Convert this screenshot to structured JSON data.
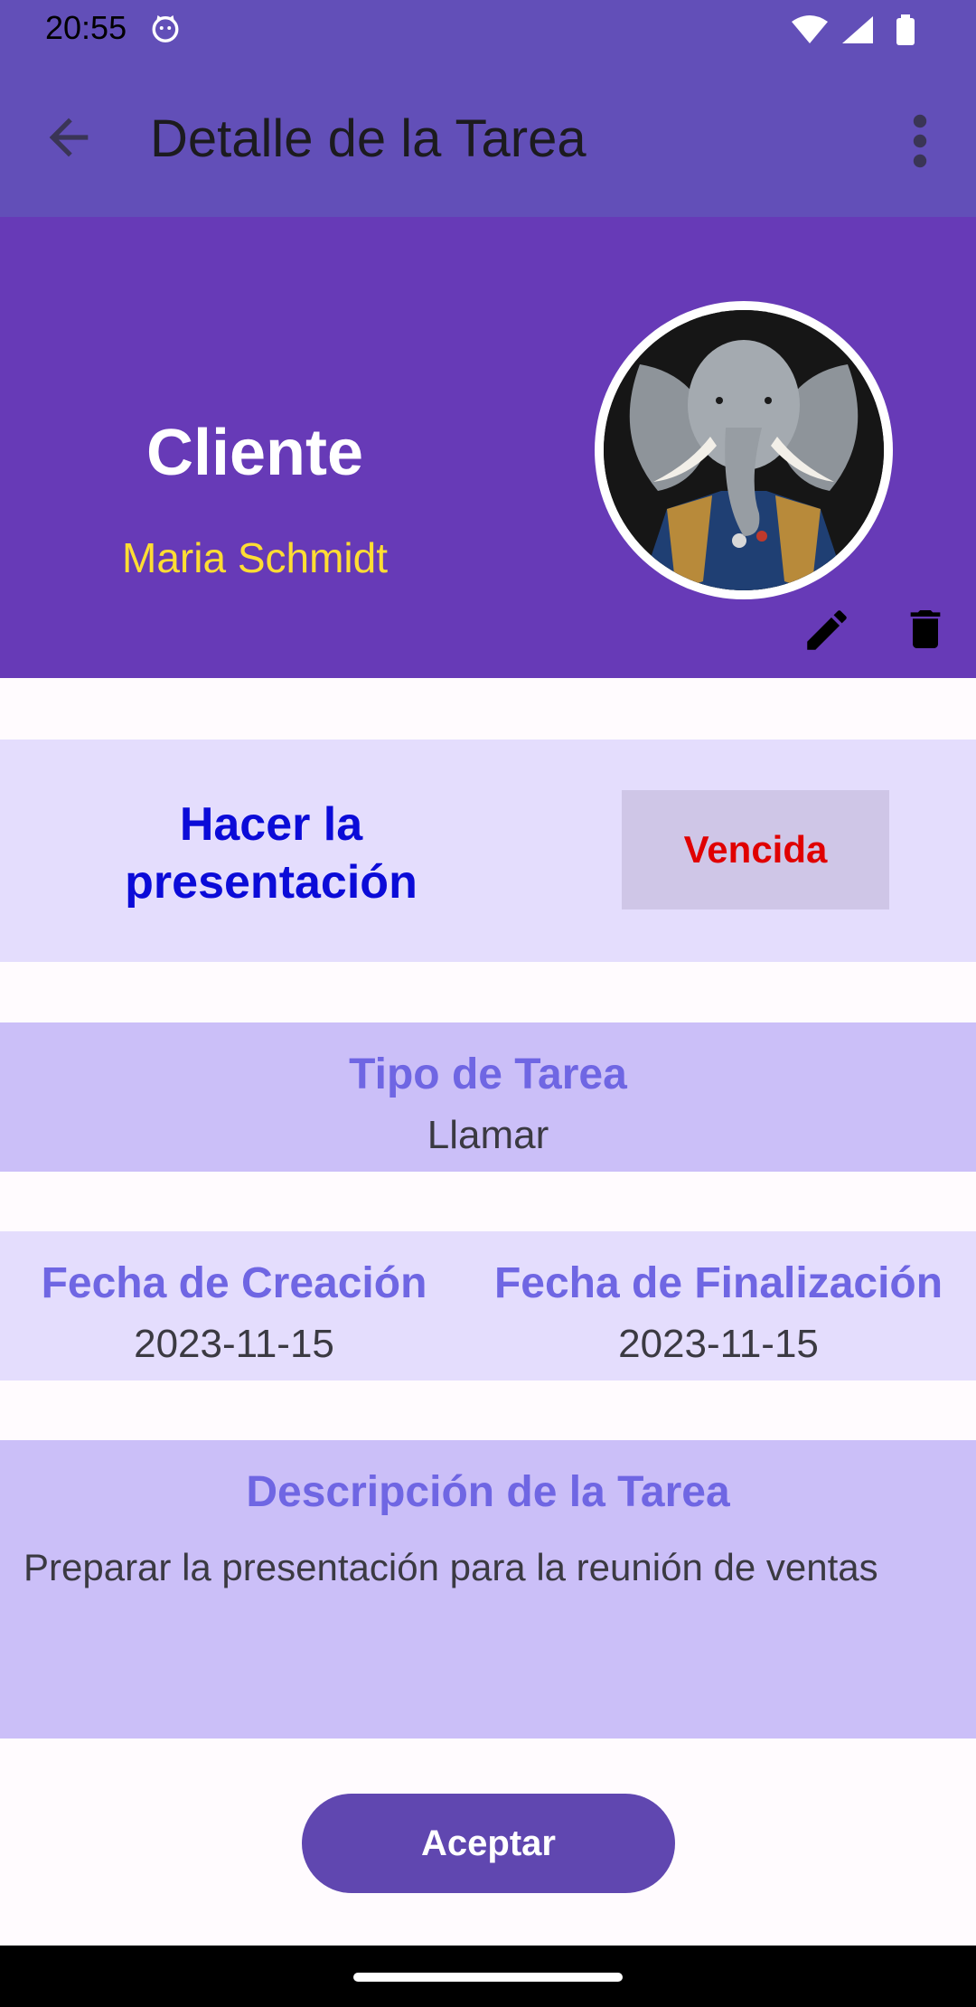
{
  "status_bar": {
    "time": "20:55"
  },
  "app_bar": {
    "title": "Detalle de la Tarea",
    "icons": [
      "back-icon",
      "overflow-icon"
    ]
  },
  "client": {
    "label": "Cliente",
    "name": "Maria Schmidt",
    "avatar": "elephant-in-uniform"
  },
  "task": {
    "title": "Hacer la presentación",
    "status": "Vencida"
  },
  "tipo": {
    "label": "Tipo de Tarea",
    "value": "Llamar"
  },
  "fechas": {
    "creacion_label": "Fecha de Creación",
    "creacion_value": "2023-11-15",
    "finalizacion_label": "Fecha de Finalización",
    "finalizacion_value": "2023-11-15"
  },
  "descripcion": {
    "label": "Descripción de la Tarea",
    "text": "Preparar la presentación para la reunión de ventas"
  },
  "actions": {
    "accept": "Aceptar"
  },
  "colors": {
    "appbar": "#624fb8",
    "header": "#673ab7",
    "accent_text": "#6f66e3",
    "status_text": "#e00000",
    "client_name": "#ffdd33",
    "button": "#6047b0"
  }
}
